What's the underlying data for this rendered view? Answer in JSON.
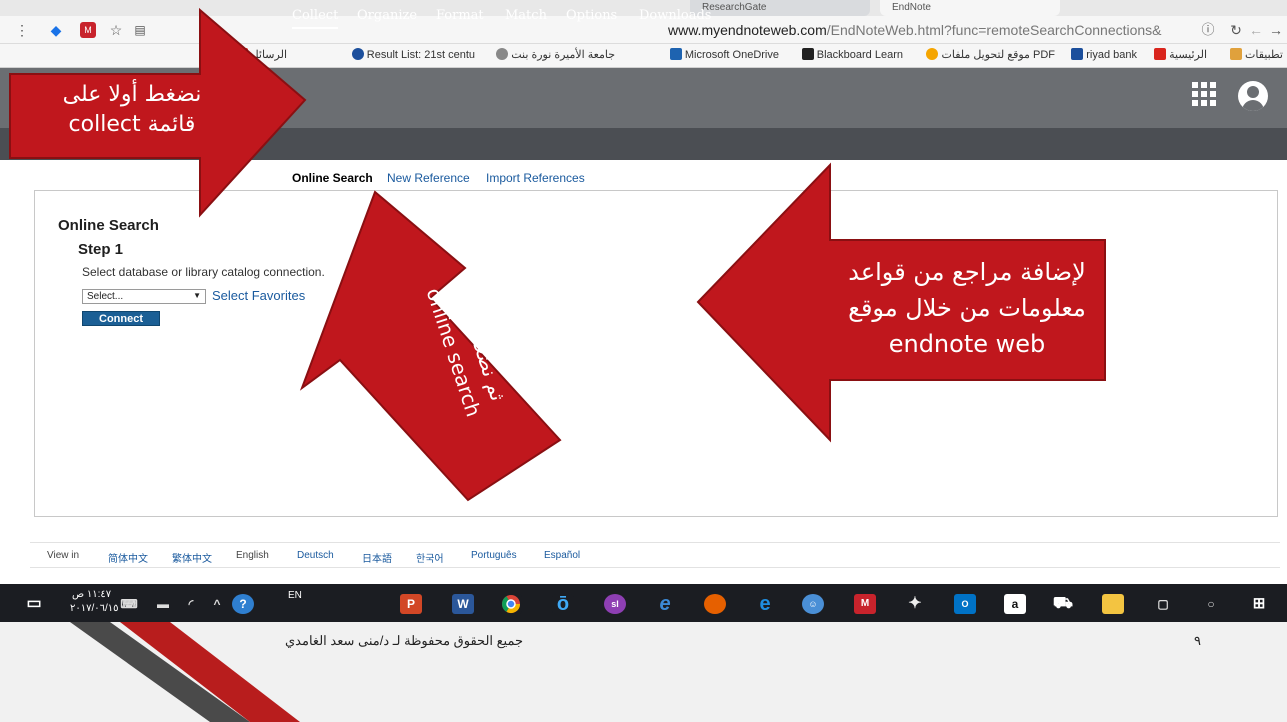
{
  "browser": {
    "tabs": [
      "ResearchGate",
      "EndNote"
    ],
    "url_host": "www.myendnoteweb.com",
    "url_path": "/EndNoteWeb.html?func=remoteSearchConnections&",
    "bookmarks": [
      "تطبيقات",
      "الرئيسية",
      "riyad bank",
      "موقع لتحويل ملفات PDF",
      "Blackboard Learn",
      "Microsoft OneDrive",
      "جامعة الأميرة نورة بنت",
      "Result List: 21st centu",
      "الرسائل"
    ]
  },
  "endnote": {
    "nav": [
      "Collect",
      "Organize",
      "Format",
      "Match",
      "Options",
      "Downloads"
    ],
    "active_nav": "Collect",
    "subnav": [
      "Online Search",
      "New Reference",
      "Import References"
    ],
    "section_title": "Online Search",
    "step_label": "Step 1",
    "instruction": "Select database or library catalog connection.",
    "select_value": "Select...",
    "favorites_link": "Select Favorites",
    "connect_button": "Connect",
    "languages": {
      "view_in": "View in",
      "list": [
        "简体中文",
        "繁体中文",
        "English",
        "Deutsch",
        "日本語",
        "한국어",
        "Português",
        "Español"
      ]
    }
  },
  "taskbar": {
    "time": "١١:٤٧ ص",
    "date": "٢٠١٧/٠٦/١٥",
    "lang": "EN"
  },
  "annotations": {
    "first_callout": "نضغط أولا على\nقائمة collect",
    "second_callout": "ثم نضغط على\nonline search",
    "third_callout": "لإضافة مراجع من قواعد\nمعلومات من خلال موقع\nendnote web"
  },
  "slide_footer": {
    "copyright": "جميع الحقوق محفوظة لـ د/منى سعد الغامدي",
    "page_number": "٩"
  },
  "colors": {
    "callout_red": "#c0171d",
    "header_gray": "#6b6e72",
    "nav_dark": "#4b4e53",
    "link_blue": "#1a5a9e",
    "connect_blue": "#1b5f95"
  }
}
